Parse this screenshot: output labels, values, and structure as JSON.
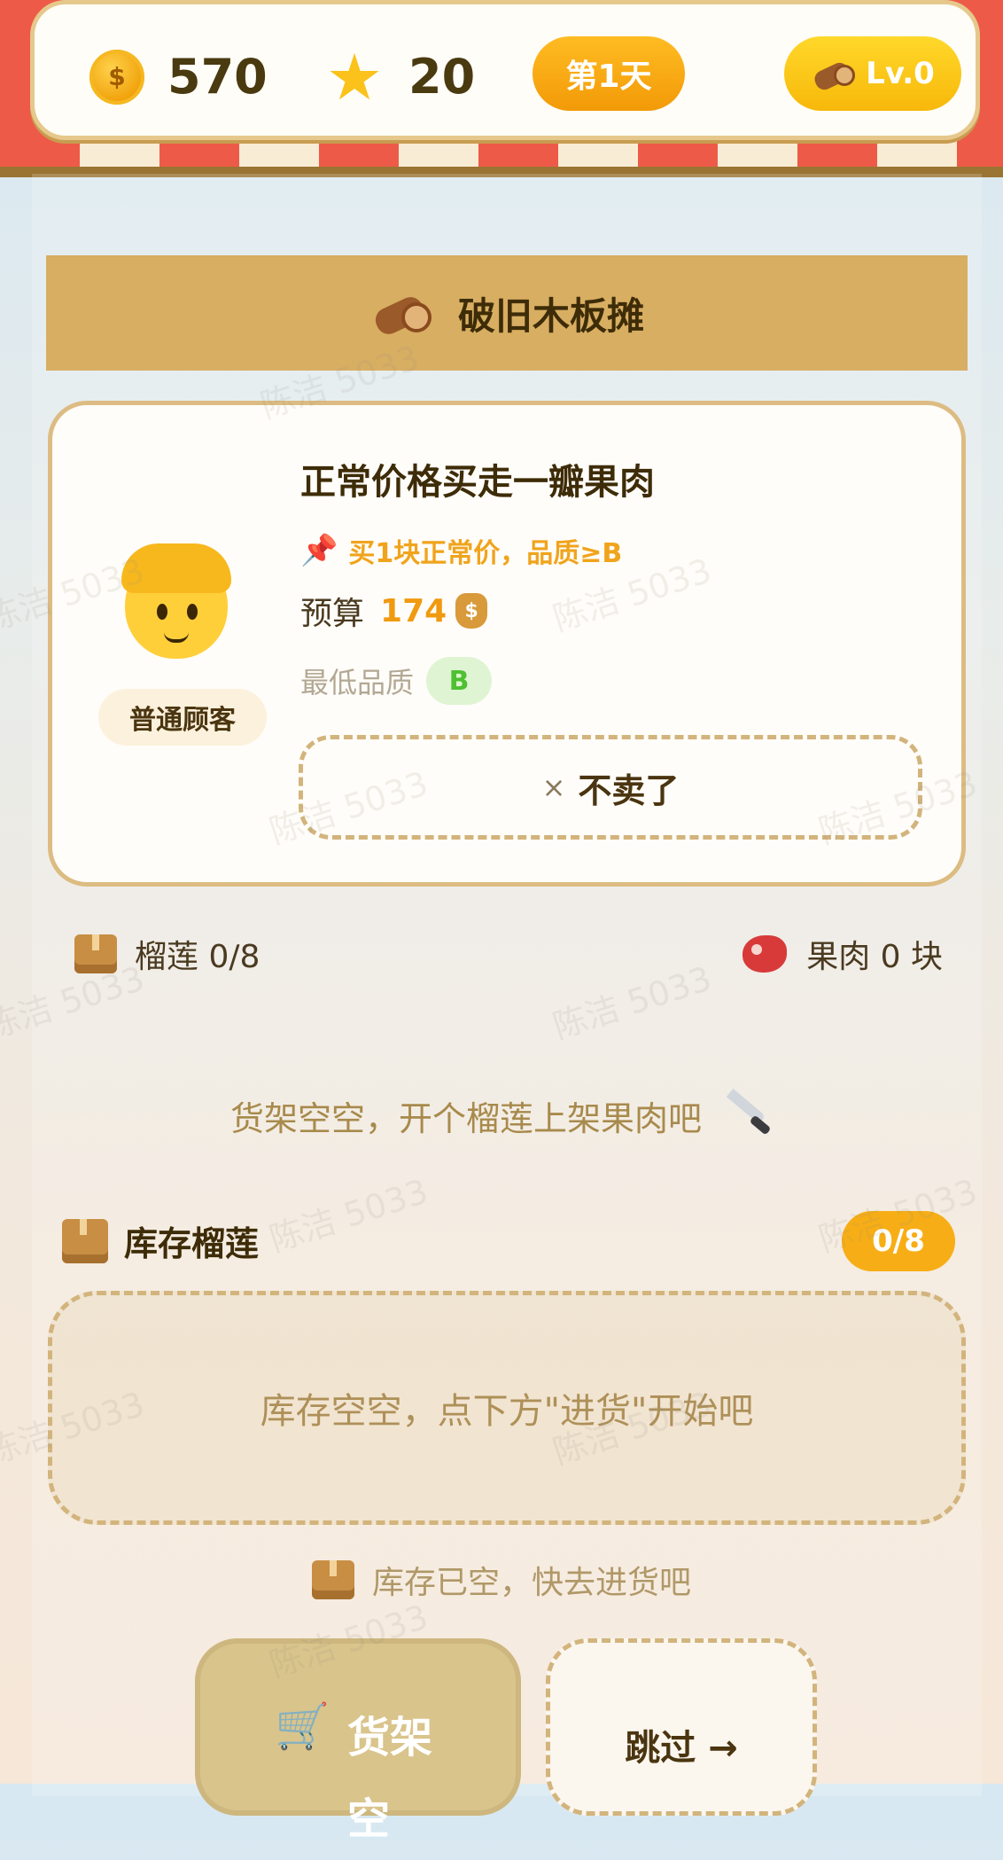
{
  "header": {
    "coins": "570",
    "coin_symbol": "$",
    "stars": "20",
    "day_label": "第1天",
    "level_label": "Lv.0"
  },
  "stall": {
    "title": "破旧木板摊"
  },
  "customer": {
    "type_label": "普通顾客",
    "request_title": "正常价格买走一瓣果肉",
    "request_note": "买1块正常价，品质≥B",
    "budget_label": "预算",
    "budget_value": "174",
    "min_quality_label": "最低品质",
    "min_quality_value": "B",
    "decline_icon": "×",
    "decline_label": "不卖了"
  },
  "counts": {
    "durian_label": "榴莲 0/8",
    "flesh_label": "果肉 0 块"
  },
  "shelf": {
    "empty_text": "货架空空，开个榴莲上架果肉吧"
  },
  "inventory": {
    "title": "库存榴莲",
    "count_badge": "0/8",
    "empty_text": "库存空空，点下方\"进货\"开始吧",
    "stock_empty_text": "库存已空，快去进货吧"
  },
  "actions": {
    "shelf_button_label": "货架空",
    "skip_button_label": "跳过 →"
  },
  "watermark": "陈洁 5033",
  "icons": {
    "coin": "coin-icon",
    "star": "star-icon",
    "log": "wood-log-icon",
    "customer": "customer-face-icon",
    "pin": "pushpin-icon",
    "bag": "money-bag-icon",
    "box": "box-icon",
    "meat": "meat-icon",
    "knife": "knife-icon",
    "cart": "cart-icon"
  },
  "colors": {
    "accent": "#f7ae16",
    "awning_red": "#ee5a48",
    "banner": "#d8ae62",
    "quality_green": "#4ec032"
  }
}
